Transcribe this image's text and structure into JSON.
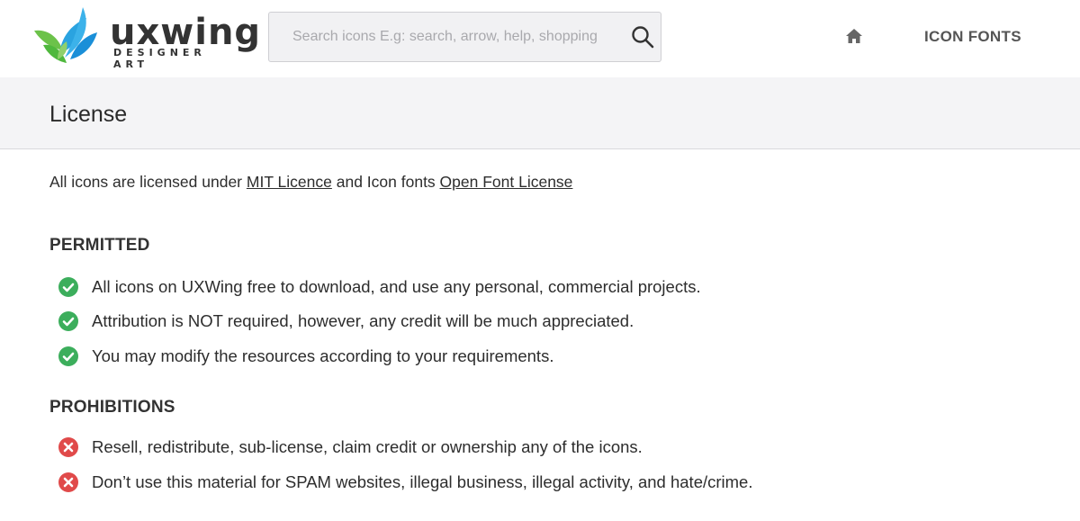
{
  "header": {
    "logo": {
      "wordmark": "uxwing",
      "tagline": "DESIGNER ART",
      "colors": {
        "leaf_green": "#4fb83d",
        "leaf_blue": "#1a8fd8",
        "text": "#333333"
      }
    },
    "search": {
      "placeholder": "Search icons E.g: search, arrow, help, shopping",
      "value": "",
      "icon": "search-icon"
    },
    "nav": {
      "home_icon": "home-icon",
      "icon_fonts_label": "ICON FONTS"
    }
  },
  "page": {
    "title": "License",
    "intro": {
      "prefix": "All icons are licensed under ",
      "mit_link": "MIT Licence",
      "middle": " and Icon fonts ",
      "ofl_link": "Open Font License"
    },
    "permitted": {
      "heading": "PERMITTED",
      "icon": "check-circle-icon",
      "color": "#3cae5c",
      "items": [
        "All icons on UXWing free to download, and use any personal, commercial projects.",
        "Attribution is NOT required, however, any credit will be much appreciated.",
        "You may modify the resources according to your requirements."
      ]
    },
    "prohibitions": {
      "heading": "PROHIBITIONS",
      "icon": "x-circle-icon",
      "color": "#e04a4a",
      "items": [
        "Resell, redistribute, sub-license, claim credit or ownership any of the icons.",
        "Don’t use this material for SPAM websites, illegal business, illegal activity, and hate/crime."
      ]
    }
  }
}
